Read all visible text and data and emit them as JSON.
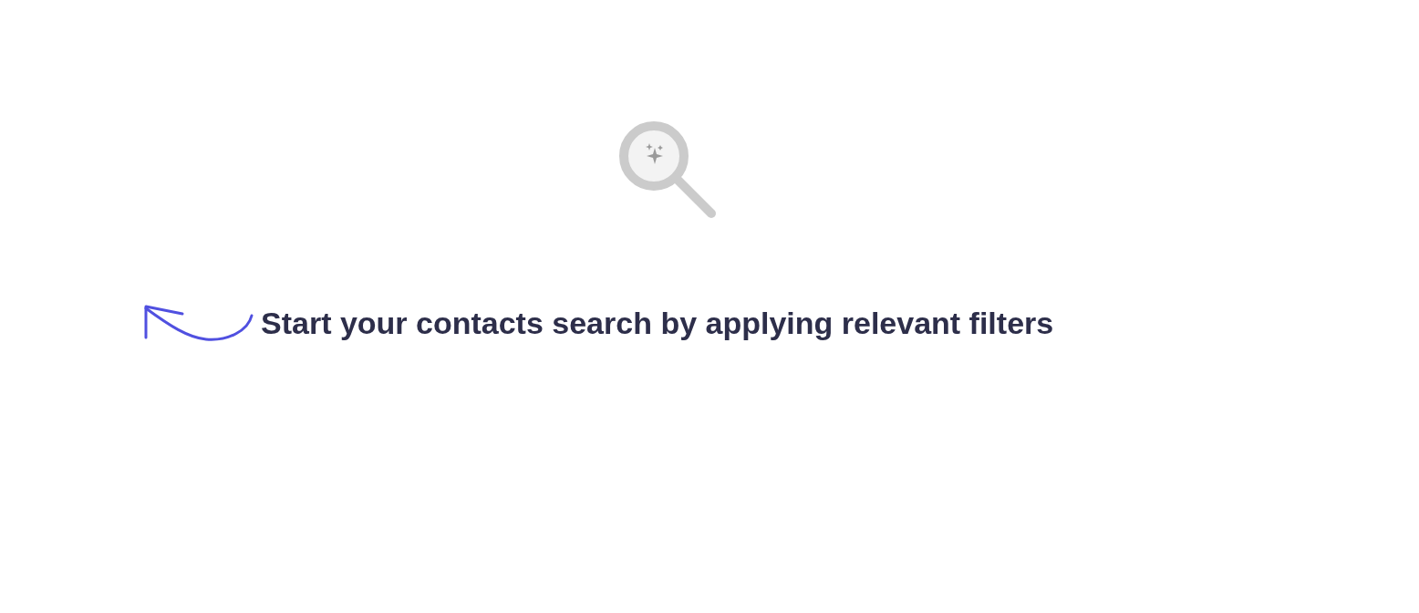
{
  "empty_state": {
    "message": "Start your contacts search by applying relevant filters"
  }
}
